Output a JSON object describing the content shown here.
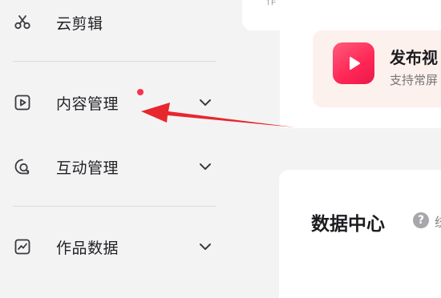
{
  "sidebar": {
    "items": [
      {
        "label": "云剪辑",
        "icon": "scissors-icon",
        "expandable": false
      },
      {
        "label": "内容管理",
        "icon": "video-play-icon",
        "expandable": true,
        "has_notification_dot": true
      },
      {
        "label": "互动管理",
        "icon": "chat-bubble-icon",
        "expandable": true
      },
      {
        "label": "作品数据",
        "icon": "chart-icon",
        "expandable": true
      }
    ]
  },
  "top_card": {
    "text": "作"
  },
  "publish": {
    "title": "发布视",
    "subtitle": "支持常屏"
  },
  "data_center": {
    "title": "数据中心",
    "help_icon": "?",
    "extra": "统"
  },
  "colors": {
    "accent": "#ff2e4d",
    "arrow": "#e8262e",
    "sidebar_bg": "#f3f3f4",
    "publish_bg": "#fdf1ed"
  }
}
